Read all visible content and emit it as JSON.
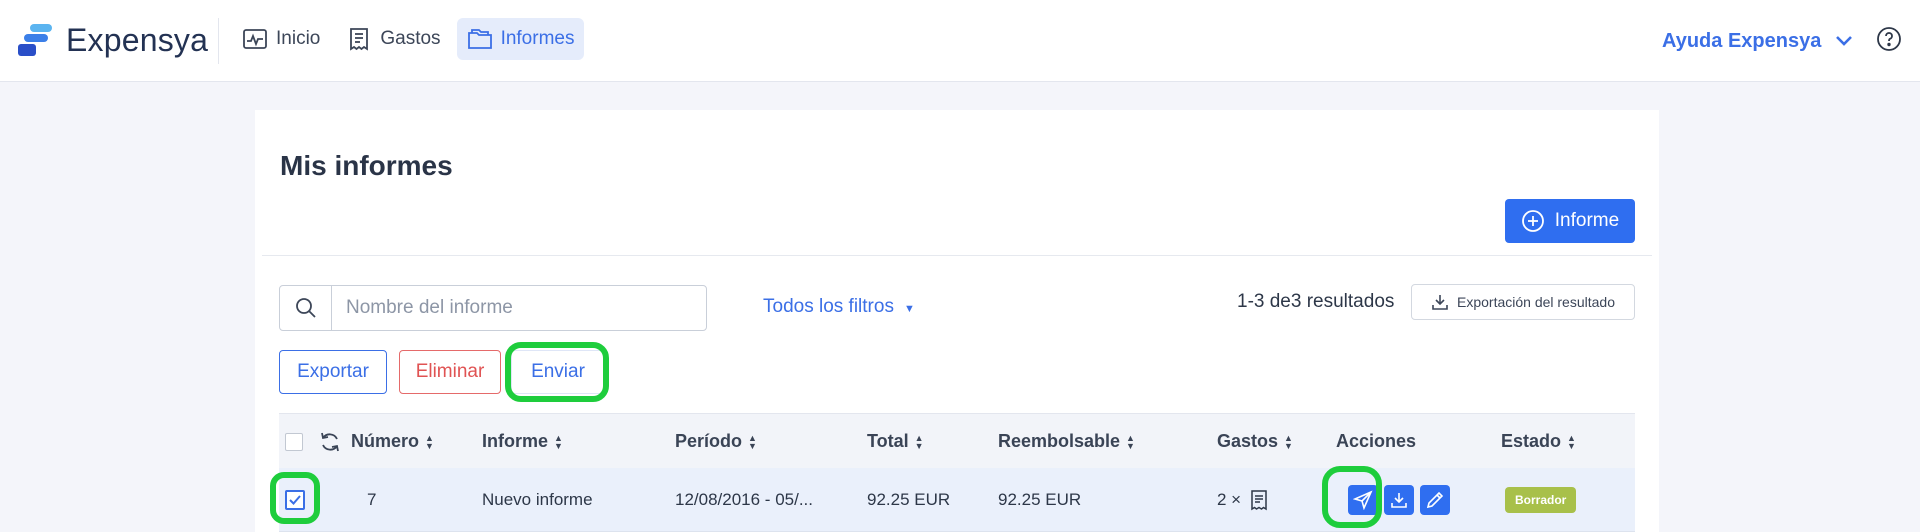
{
  "app": {
    "name": "Expensya",
    "brand_color": "#2f6ef0",
    "highlight_color": "#1ecd3c"
  },
  "nav": {
    "items": [
      {
        "label": "Inicio",
        "icon": "activity-chart-icon",
        "active": false
      },
      {
        "label": "Gastos",
        "icon": "receipt-icon",
        "active": false
      },
      {
        "label": "Informes",
        "icon": "folder-icon",
        "active": true
      }
    ]
  },
  "header": {
    "help_label": "Ayuda Expensya",
    "help_icon": "question-circle-icon"
  },
  "page": {
    "title": "Mis informes",
    "new_report_label": "Informe",
    "search_placeholder": "Nombre del informe",
    "filters_label": "Todos los filtros",
    "results_text": "1-3 de3 resultados",
    "export_results_label": "Exportación del resultado",
    "bulk_actions": {
      "export": "Exportar",
      "delete": "Eliminar",
      "send": "Enviar"
    }
  },
  "table": {
    "columns": {
      "numero": "Número",
      "informe": "Informe",
      "periodo": "Período",
      "total": "Total",
      "reembolsable": "Reembolsable",
      "gastos": "Gastos",
      "acciones": "Acciones",
      "estado": "Estado"
    },
    "rows": [
      {
        "checked": true,
        "numero": "7",
        "informe": "Nuevo informe",
        "periodo": "12/08/2016 - 05/...",
        "total": "92.25 EUR",
        "reembolsable": "92.25 EUR",
        "gastos": "2 ×",
        "estado": "Borrador"
      }
    ]
  }
}
